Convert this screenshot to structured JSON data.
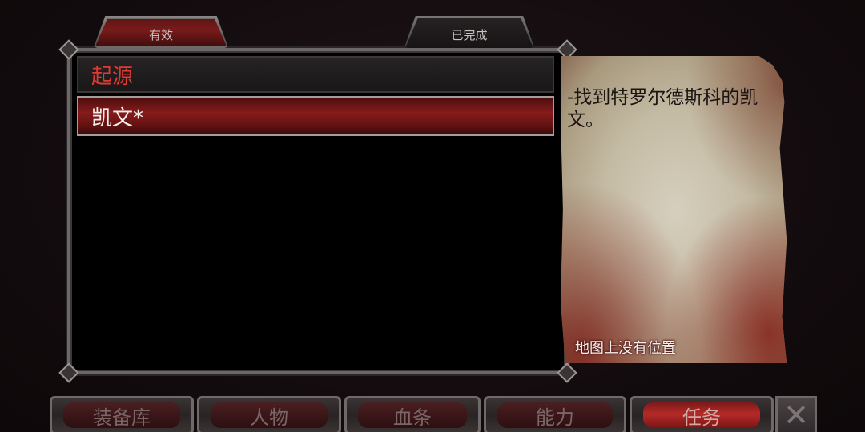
{
  "tabs": {
    "active_label": "有效",
    "completed_label": "已完成"
  },
  "quest_list": {
    "category_header": "起源",
    "selected_quest": "凯文*"
  },
  "quest_detail": {
    "description": "-找到特罗尔德斯科的凯文。",
    "map_status": "地图上没有位置"
  },
  "bottom_nav": {
    "inventory_label": "装备库",
    "character_label": "人物",
    "health_bar_label": "血条",
    "abilities_label": "能力",
    "quests_label": "任务"
  },
  "icons": {
    "close": "close-icon"
  },
  "colors": {
    "header_red": "#e03b32",
    "selected_row_red": "#861b1b",
    "active_tab_red": "#7a1a1a"
  }
}
